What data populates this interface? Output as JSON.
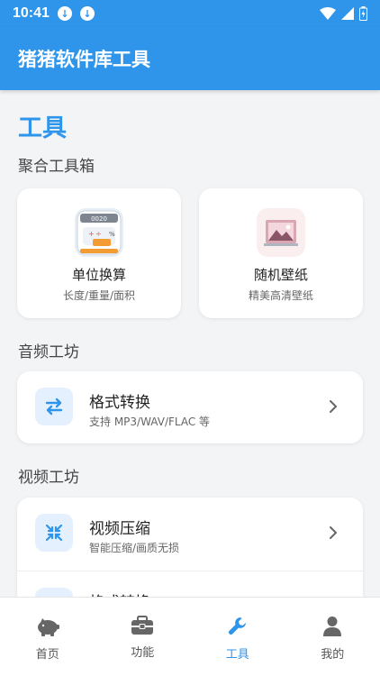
{
  "status": {
    "time": "10:41"
  },
  "app_title": "猪猪软件库工具",
  "page_title": "工具",
  "sections": {
    "toolbox": "聚合工具箱",
    "audio": "音频工坊",
    "video": "视频工坊"
  },
  "toolbox_cards": [
    {
      "title": "单位换算",
      "subtitle": "长度/重量/面积",
      "icon": "calculator-icon"
    },
    {
      "title": "随机壁纸",
      "subtitle": "精美高清壁纸",
      "icon": "wallpaper-icon"
    }
  ],
  "audio_items": [
    {
      "title": "格式转换",
      "subtitle": "支持 MP3/WAV/FLAC 等",
      "icon": "swap-arrows-icon"
    }
  ],
  "video_items": [
    {
      "title": "视频压缩",
      "subtitle": "智能压缩/画质无损",
      "icon": "compress-icon"
    },
    {
      "title": "格式转换",
      "subtitle": "",
      "icon": "convert-icon"
    }
  ],
  "bottom_nav": [
    {
      "label": "首页",
      "icon": "piggy-bank-icon",
      "active": false
    },
    {
      "label": "功能",
      "icon": "toolbox-icon",
      "active": false
    },
    {
      "label": "工具",
      "icon": "wrench-icon",
      "active": true
    },
    {
      "label": "我的",
      "icon": "user-icon",
      "active": false
    }
  ],
  "colors": {
    "primary": "#2f95ea",
    "background": "#f3f4f6"
  }
}
